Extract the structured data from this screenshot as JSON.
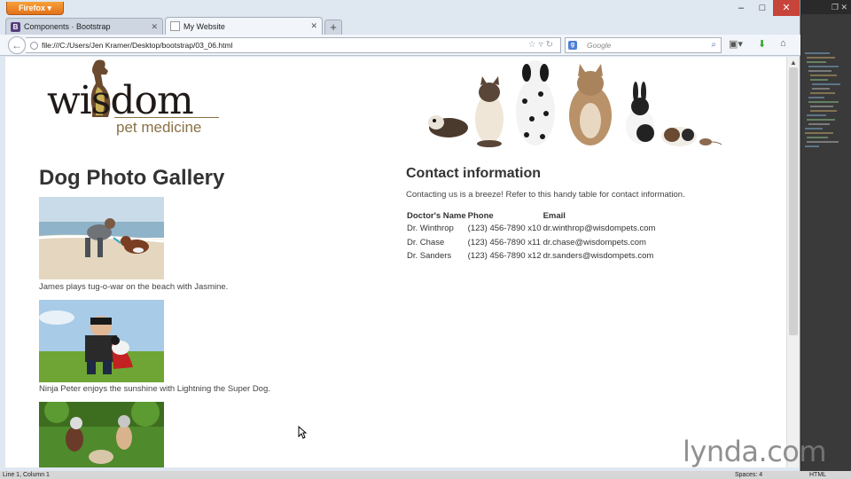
{
  "browser": {
    "menu_button": "Firefox",
    "tabs": [
      {
        "label": "Components · Bootstrap",
        "favicon": "bootstrap-icon",
        "active": false
      },
      {
        "label": "My Website",
        "favicon": "page-icon",
        "active": true
      }
    ],
    "url": "file:///C:/Users/Jen Kramer/Desktop/bootstrap/03_06.html",
    "search_placeholder": "Google"
  },
  "page": {
    "logo": {
      "word": "wisdom",
      "sub": "pet medicine"
    },
    "gallery": {
      "title": "Dog Photo Gallery",
      "items": [
        {
          "caption": "James plays tug-o-war on the beach with Jasmine."
        },
        {
          "caption": "Ninja Peter enjoys the sunshine with Lightning the Super Dog."
        },
        {
          "caption": ""
        }
      ]
    },
    "contact": {
      "title": "Contact information",
      "intro": "Contacting us is a breeze! Refer to this handy table for contact information.",
      "headers": [
        "Doctor's Name",
        "Phone",
        "Email"
      ],
      "rows": [
        [
          "Dr. Winthrop",
          "(123) 456-7890 x10",
          "dr.winthrop@wisdompets.com"
        ],
        [
          "Dr. Chase",
          "(123) 456-7890 x11",
          "dr.chase@wisdompets.com"
        ],
        [
          "Dr. Sanders",
          "(123) 456-7890 x12",
          "dr.sanders@wisdompets.com"
        ]
      ]
    }
  },
  "statusbar": {
    "position": "Line 1, Column 1",
    "spaces": "Spaces: 4",
    "language": "HTML"
  },
  "watermark": "lynda.com",
  "colors": {
    "firefox_orange": "#e8821f",
    "close_red": "#c7443a",
    "logo_tan": "#8a7045"
  }
}
